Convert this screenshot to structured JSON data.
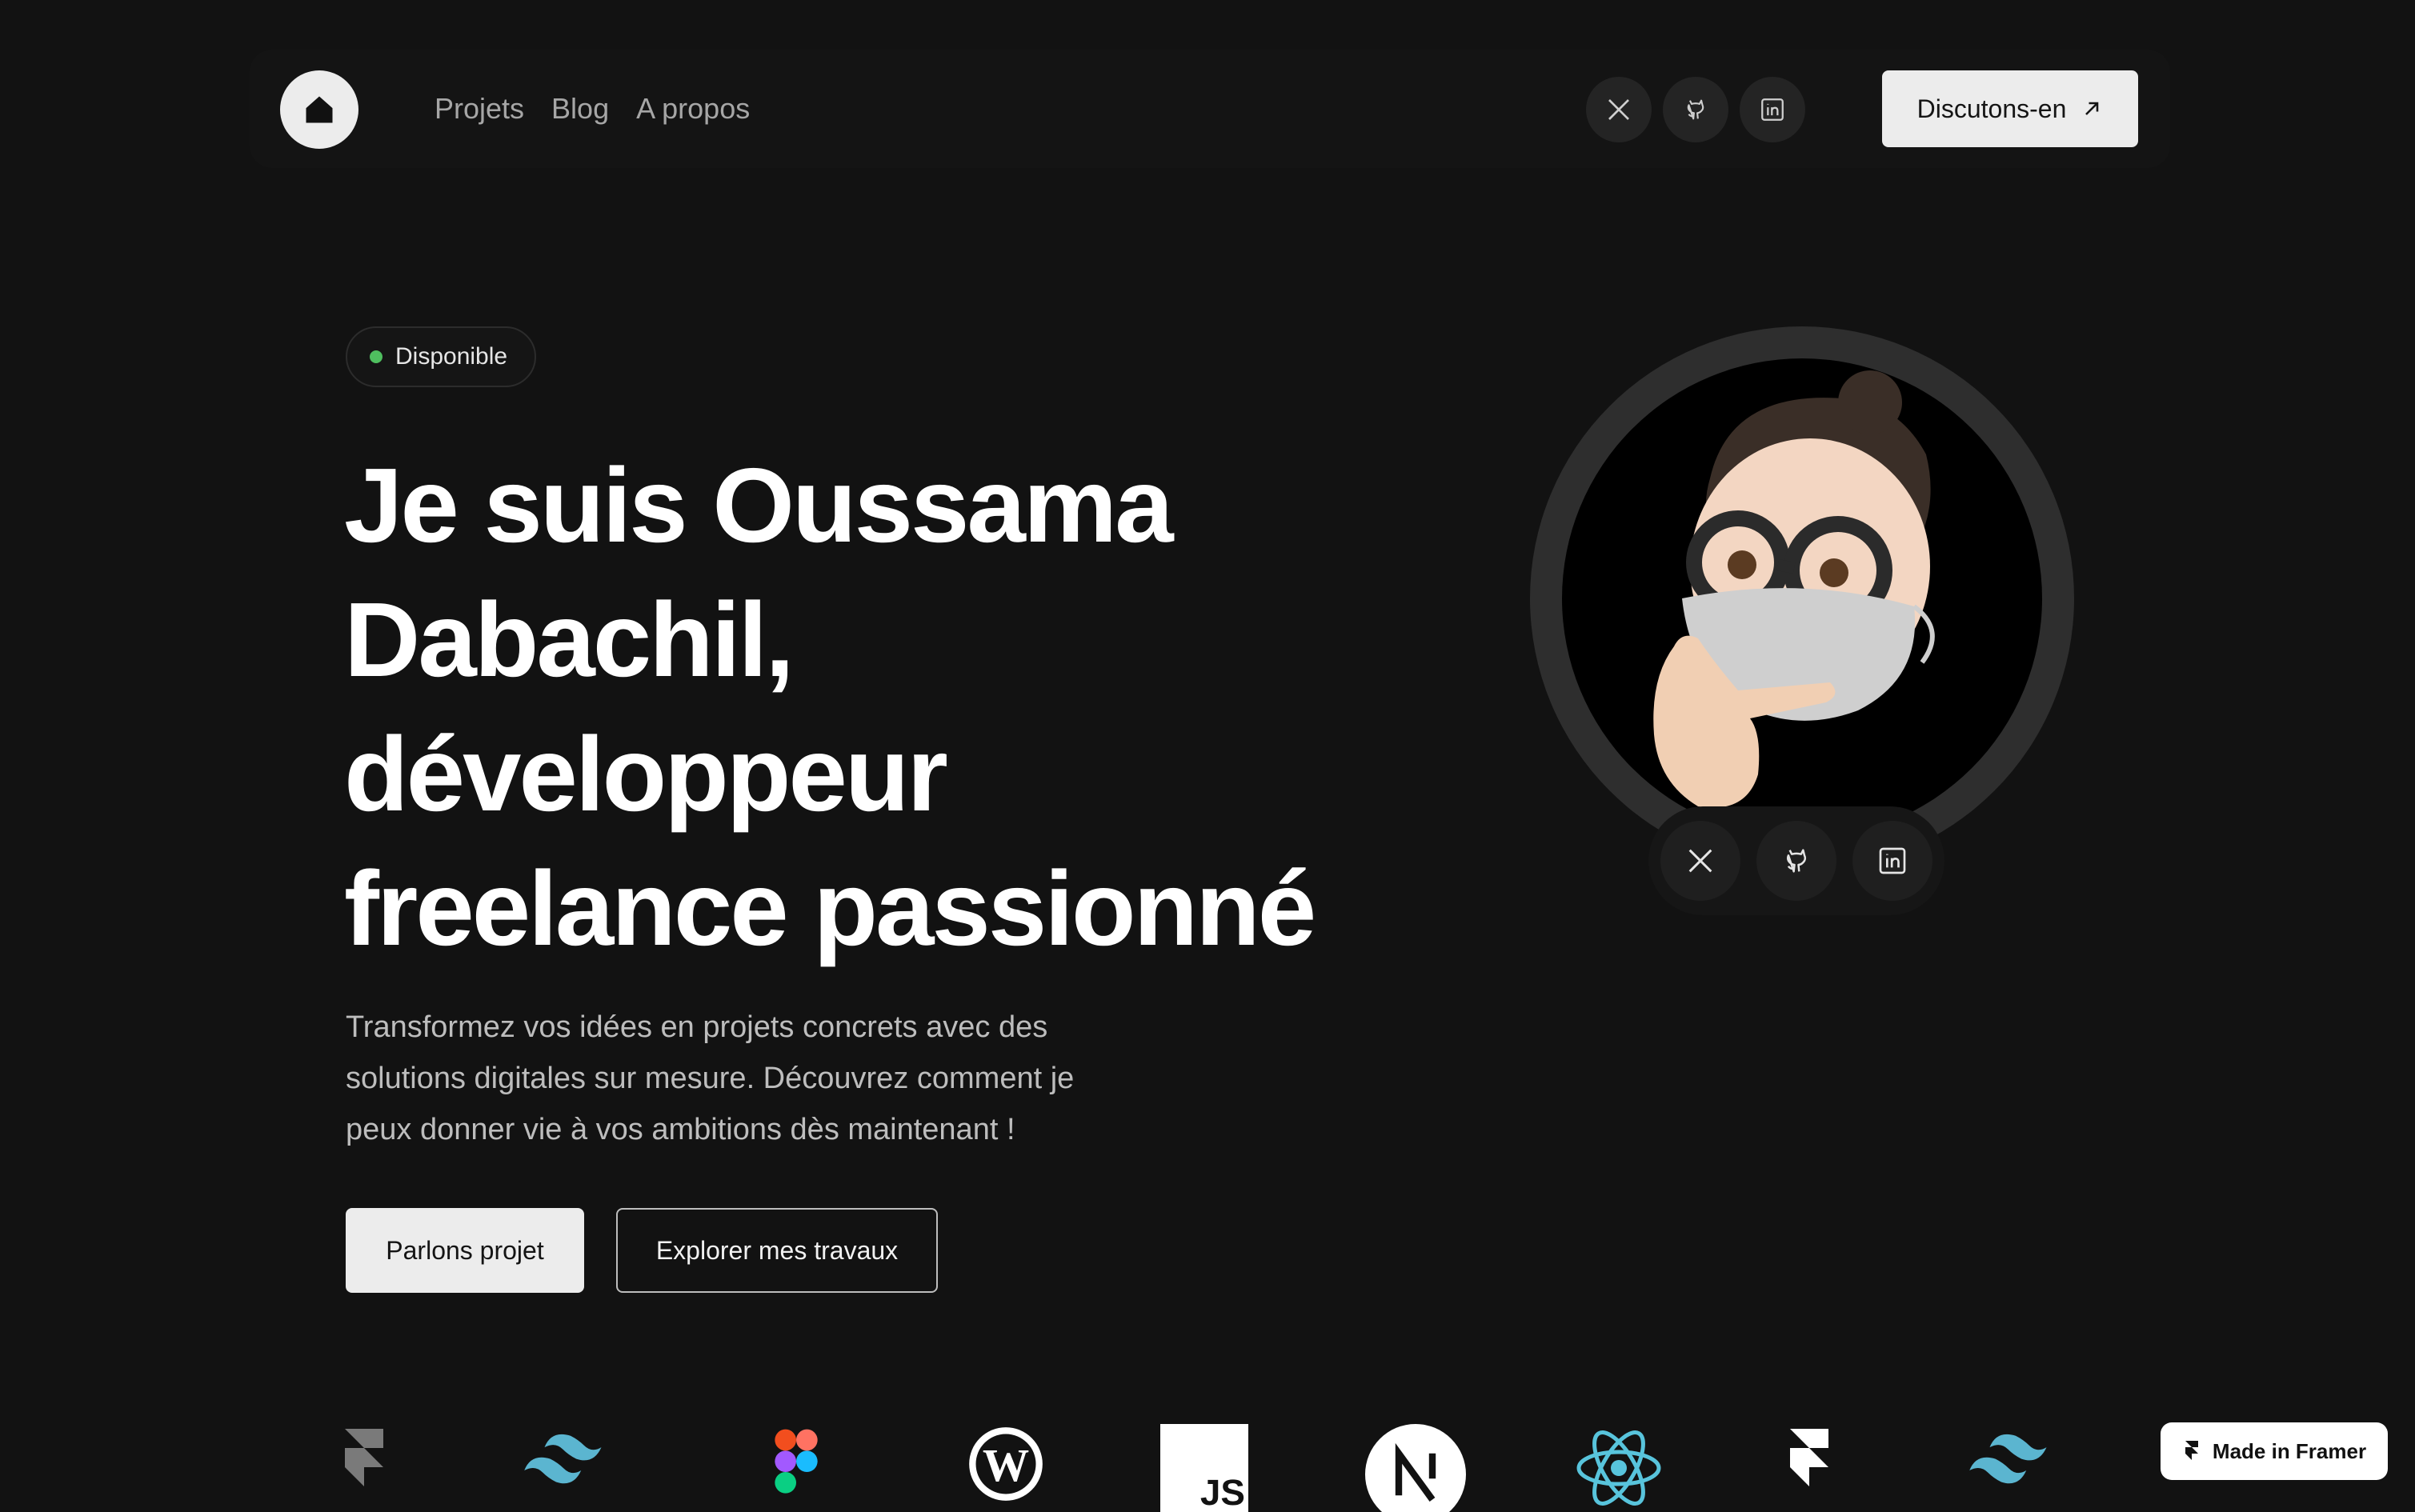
{
  "nav": {
    "links": [
      "Projets",
      "Blog",
      "A propos"
    ],
    "cta_label": "Discutons-en",
    "social_icons": [
      "x-icon",
      "github-icon",
      "linkedin-icon"
    ]
  },
  "hero": {
    "badge_label": "Disponible",
    "headline_lines": [
      "Je suis Oussama",
      "Dabachil,",
      "développeur",
      "freelance passionné"
    ],
    "subtitle_lines": [
      "Transformez vos idées en projets concrets avec des",
      "solutions digitales sur mesure. Découvrez comment je",
      "peux donner vie à vos ambitions dès maintenant !"
    ],
    "primary_button": "Parlons projet",
    "secondary_button": "Explorer mes travaux"
  },
  "avatar": {
    "social_icons": [
      "x-icon",
      "github-icon",
      "linkedin-icon"
    ]
  },
  "tech_logos": [
    "framer",
    "tailwind",
    "figma",
    "wordpress",
    "javascript",
    "nextjs",
    "react",
    "framer",
    "tailwind"
  ],
  "badge_footer": {
    "label": "Made in Framer"
  },
  "colors": {
    "background": "#121212",
    "button_light": "#ececec",
    "status_green": "#4fbf5f",
    "icon_bg": "#242424"
  }
}
